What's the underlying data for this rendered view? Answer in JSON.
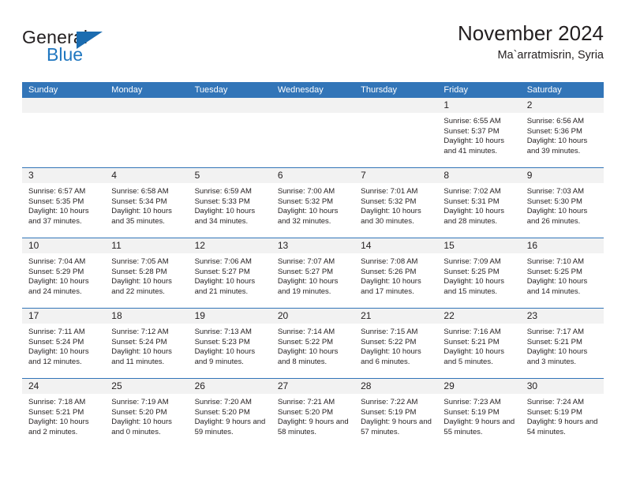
{
  "logo": {
    "word_top": "General",
    "word_bottom": "Blue",
    "icon": "triangle-logo-icon",
    "color_dark": "#231f20",
    "color_blue": "#2077c0"
  },
  "header": {
    "title": "November 2024",
    "subtitle": "Ma`arratmisrin, Syria"
  },
  "theme": {
    "header_blue": "#3275b8",
    "date_strip_gray": "#f2f2f2",
    "text": "#231f20",
    "page_background": "#ffffff"
  },
  "calendar": {
    "weekday_headers": [
      "Sunday",
      "Monday",
      "Tuesday",
      "Wednesday",
      "Thursday",
      "Friday",
      "Saturday"
    ],
    "labels": {
      "sunrise": "Sunrise:",
      "sunset": "Sunset:",
      "daylight": "Daylight:"
    },
    "weeks": [
      [
        {
          "date": "",
          "empty": true
        },
        {
          "date": "",
          "empty": true
        },
        {
          "date": "",
          "empty": true
        },
        {
          "date": "",
          "empty": true
        },
        {
          "date": "",
          "empty": true
        },
        {
          "date": "1",
          "sunrise": "Sunrise: 6:55 AM",
          "sunset": "Sunset: 5:37 PM",
          "daylight": "Daylight: 10 hours and 41 minutes."
        },
        {
          "date": "2",
          "sunrise": "Sunrise: 6:56 AM",
          "sunset": "Sunset: 5:36 PM",
          "daylight": "Daylight: 10 hours and 39 minutes."
        }
      ],
      [
        {
          "date": "3",
          "sunrise": "Sunrise: 6:57 AM",
          "sunset": "Sunset: 5:35 PM",
          "daylight": "Daylight: 10 hours and 37 minutes."
        },
        {
          "date": "4",
          "sunrise": "Sunrise: 6:58 AM",
          "sunset": "Sunset: 5:34 PM",
          "daylight": "Daylight: 10 hours and 35 minutes."
        },
        {
          "date": "5",
          "sunrise": "Sunrise: 6:59 AM",
          "sunset": "Sunset: 5:33 PM",
          "daylight": "Daylight: 10 hours and 34 minutes."
        },
        {
          "date": "6",
          "sunrise": "Sunrise: 7:00 AM",
          "sunset": "Sunset: 5:32 PM",
          "daylight": "Daylight: 10 hours and 32 minutes."
        },
        {
          "date": "7",
          "sunrise": "Sunrise: 7:01 AM",
          "sunset": "Sunset: 5:32 PM",
          "daylight": "Daylight: 10 hours and 30 minutes."
        },
        {
          "date": "8",
          "sunrise": "Sunrise: 7:02 AM",
          "sunset": "Sunset: 5:31 PM",
          "daylight": "Daylight: 10 hours and 28 minutes."
        },
        {
          "date": "9",
          "sunrise": "Sunrise: 7:03 AM",
          "sunset": "Sunset: 5:30 PM",
          "daylight": "Daylight: 10 hours and 26 minutes."
        }
      ],
      [
        {
          "date": "10",
          "sunrise": "Sunrise: 7:04 AM",
          "sunset": "Sunset: 5:29 PM",
          "daylight": "Daylight: 10 hours and 24 minutes."
        },
        {
          "date": "11",
          "sunrise": "Sunrise: 7:05 AM",
          "sunset": "Sunset: 5:28 PM",
          "daylight": "Daylight: 10 hours and 22 minutes."
        },
        {
          "date": "12",
          "sunrise": "Sunrise: 7:06 AM",
          "sunset": "Sunset: 5:27 PM",
          "daylight": "Daylight: 10 hours and 21 minutes."
        },
        {
          "date": "13",
          "sunrise": "Sunrise: 7:07 AM",
          "sunset": "Sunset: 5:27 PM",
          "daylight": "Daylight: 10 hours and 19 minutes."
        },
        {
          "date": "14",
          "sunrise": "Sunrise: 7:08 AM",
          "sunset": "Sunset: 5:26 PM",
          "daylight": "Daylight: 10 hours and 17 minutes."
        },
        {
          "date": "15",
          "sunrise": "Sunrise: 7:09 AM",
          "sunset": "Sunset: 5:25 PM",
          "daylight": "Daylight: 10 hours and 15 minutes."
        },
        {
          "date": "16",
          "sunrise": "Sunrise: 7:10 AM",
          "sunset": "Sunset: 5:25 PM",
          "daylight": "Daylight: 10 hours and 14 minutes."
        }
      ],
      [
        {
          "date": "17",
          "sunrise": "Sunrise: 7:11 AM",
          "sunset": "Sunset: 5:24 PM",
          "daylight": "Daylight: 10 hours and 12 minutes."
        },
        {
          "date": "18",
          "sunrise": "Sunrise: 7:12 AM",
          "sunset": "Sunset: 5:24 PM",
          "daylight": "Daylight: 10 hours and 11 minutes."
        },
        {
          "date": "19",
          "sunrise": "Sunrise: 7:13 AM",
          "sunset": "Sunset: 5:23 PM",
          "daylight": "Daylight: 10 hours and 9 minutes."
        },
        {
          "date": "20",
          "sunrise": "Sunrise: 7:14 AM",
          "sunset": "Sunset: 5:22 PM",
          "daylight": "Daylight: 10 hours and 8 minutes."
        },
        {
          "date": "21",
          "sunrise": "Sunrise: 7:15 AM",
          "sunset": "Sunset: 5:22 PM",
          "daylight": "Daylight: 10 hours and 6 minutes."
        },
        {
          "date": "22",
          "sunrise": "Sunrise: 7:16 AM",
          "sunset": "Sunset: 5:21 PM",
          "daylight": "Daylight: 10 hours and 5 minutes."
        },
        {
          "date": "23",
          "sunrise": "Sunrise: 7:17 AM",
          "sunset": "Sunset: 5:21 PM",
          "daylight": "Daylight: 10 hours and 3 minutes."
        }
      ],
      [
        {
          "date": "24",
          "sunrise": "Sunrise: 7:18 AM",
          "sunset": "Sunset: 5:21 PM",
          "daylight": "Daylight: 10 hours and 2 minutes."
        },
        {
          "date": "25",
          "sunrise": "Sunrise: 7:19 AM",
          "sunset": "Sunset: 5:20 PM",
          "daylight": "Daylight: 10 hours and 0 minutes."
        },
        {
          "date": "26",
          "sunrise": "Sunrise: 7:20 AM",
          "sunset": "Sunset: 5:20 PM",
          "daylight": "Daylight: 9 hours and 59 minutes."
        },
        {
          "date": "27",
          "sunrise": "Sunrise: 7:21 AM",
          "sunset": "Sunset: 5:20 PM",
          "daylight": "Daylight: 9 hours and 58 minutes."
        },
        {
          "date": "28",
          "sunrise": "Sunrise: 7:22 AM",
          "sunset": "Sunset: 5:19 PM",
          "daylight": "Daylight: 9 hours and 57 minutes."
        },
        {
          "date": "29",
          "sunrise": "Sunrise: 7:23 AM",
          "sunset": "Sunset: 5:19 PM",
          "daylight": "Daylight: 9 hours and 55 minutes."
        },
        {
          "date": "30",
          "sunrise": "Sunrise: 7:24 AM",
          "sunset": "Sunset: 5:19 PM",
          "daylight": "Daylight: 9 hours and 54 minutes."
        }
      ]
    ]
  }
}
